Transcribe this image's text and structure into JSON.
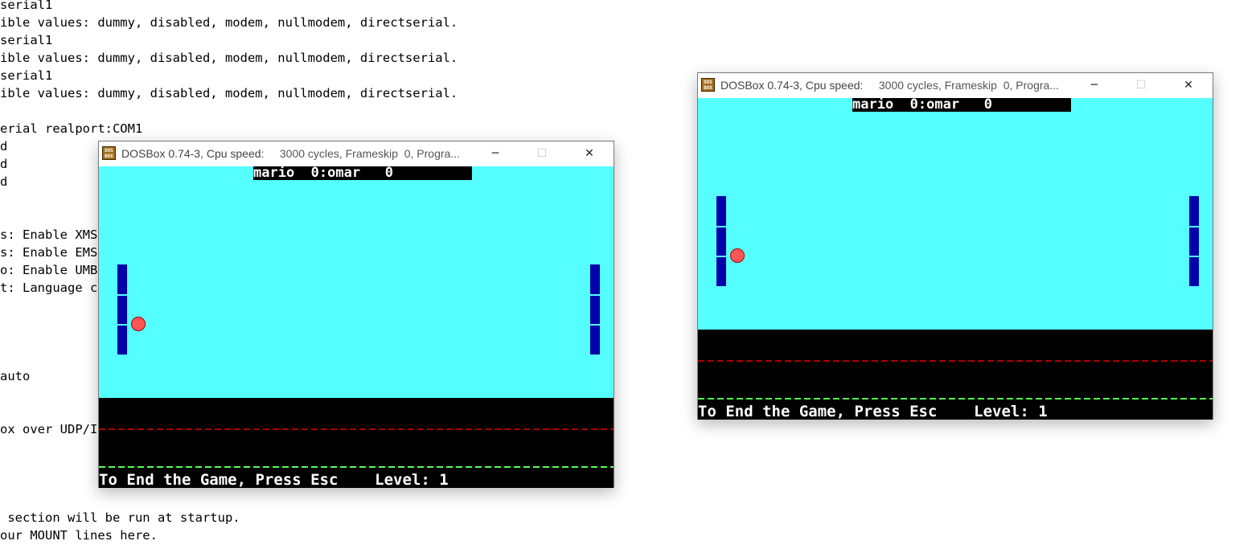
{
  "background_terminal": {
    "lines": [
      "serial1",
      "ible values: dummy, disabled, modem, nullmodem, directserial.",
      "serial1",
      "ible values: dummy, disabled, modem, nullmodem, directserial.",
      "serial1",
      "ible values: dummy, disabled, modem, nullmodem, directserial.",
      "",
      "erial realport:COM1",
      "d",
      "d",
      "d",
      "",
      "",
      "s: Enable XMS",
      "s: Enable EMS",
      "o: Enable UMB",
      "t: Language c",
      "",
      "",
      "",
      "",
      "auto",
      "",
      "",
      "ox over UDP/I",
      "",
      "",
      "",
      "",
      " section will be run at startup.",
      "our MOUNT lines here."
    ]
  },
  "windows": [
    {
      "icon_text": "DOS BOX",
      "title_prefix": "DOSBox 0.74-3, Cpu speed:",
      "title_rest": "3000 cycles, Frameskip  0, Progra...",
      "minimize": "─",
      "maximize": "☐",
      "close": "✕",
      "game": {
        "score_text": "mario  0:omar   0",
        "status_text": "To End the Game, Press Esc    Level: 1"
      }
    },
    {
      "icon_text": "DOS BOX",
      "title_prefix": "DOSBox 0.74-3, Cpu speed:",
      "title_rest": "3000 cycles, Frameskip  0, Progra...",
      "minimize": "─",
      "maximize": "☐",
      "close": "✕",
      "game": {
        "score_text": "mario  0:omar   0",
        "status_text": "To End the Game, Press Esc    Level: 1"
      }
    }
  ],
  "colors": {
    "field": "#55ffff",
    "paddle": "#0000aa",
    "ball": "#ff5555",
    "red_line": "#aa0000",
    "green_line": "#55ff55"
  }
}
